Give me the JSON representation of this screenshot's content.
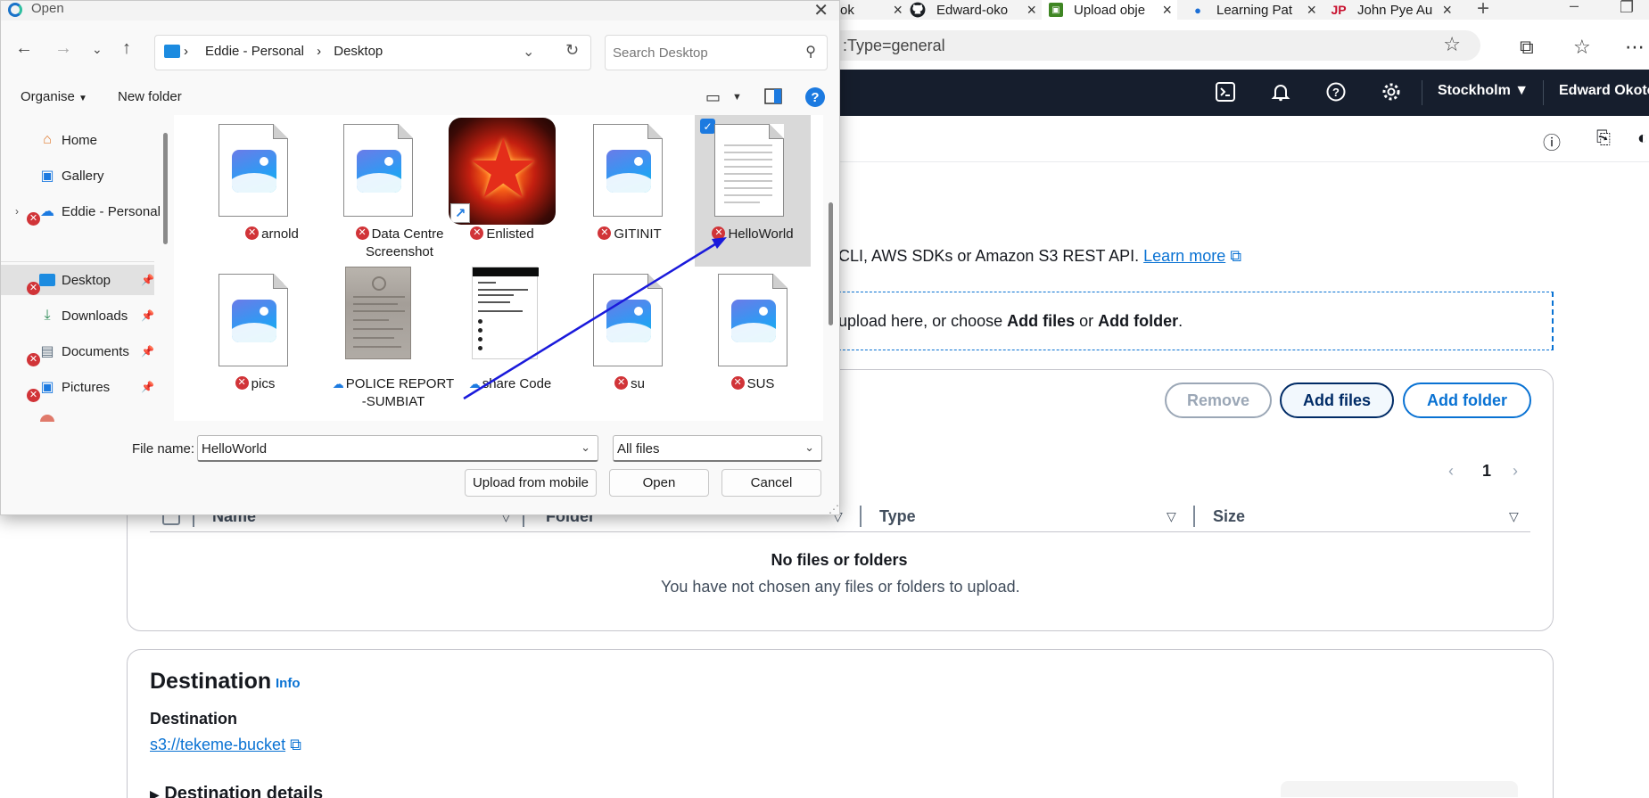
{
  "browser": {
    "tabs": [
      {
        "label": "ok",
        "icon": "book-icon"
      },
      {
        "label": "Edward-oko",
        "icon": "github-icon"
      },
      {
        "label": "Upload obje",
        "icon": "s3-icon"
      },
      {
        "label": "Learning Pat",
        "icon": "learning-icon"
      },
      {
        "label": "John Pye Au",
        "icon": "jp-icon"
      }
    ],
    "url": ":Type=general"
  },
  "aws_header": {
    "region": "Stockholm",
    "user": "Edward Okoto"
  },
  "upload": {
    "desc_prefix": "CLI, AWS SDKs or Amazon S3 REST API.",
    "learn_more": "Learn more",
    "drop_prefix": "upload here, or choose ",
    "drop_add_files": "Add files",
    "drop_or": " or ",
    "drop_add_folder": "Add folder",
    "drop_end": ".",
    "remove_label": "Remove",
    "add_files_label": "Add files",
    "add_folder_label": "Add folder",
    "page_number": "1",
    "columns": {
      "name": "Name",
      "folder": "Folder",
      "type": "Type",
      "size": "Size"
    },
    "empty_title": "No files or folders",
    "empty_sub": "You have not chosen any files or folders to upload."
  },
  "destination": {
    "title": "Destination",
    "info": "Info",
    "label": "Destination",
    "link": "s3://tekeme-bucket",
    "details": "Destination details"
  },
  "dialog": {
    "title": "Open",
    "breadcrumb": [
      "Eddie - Personal",
      "Desktop"
    ],
    "search_placeholder": "Search Desktop",
    "organise": "Organise",
    "new_folder": "New folder",
    "nav_items": [
      {
        "label": "Home",
        "icon": "home-icon"
      },
      {
        "label": "Gallery",
        "icon": "gallery-icon"
      },
      {
        "label": "Eddie - Personal",
        "icon": "onedrive-cloud-icon"
      },
      {
        "label": "Desktop",
        "icon": "desktop-folder-icon"
      },
      {
        "label": "Downloads",
        "icon": "download-icon"
      },
      {
        "label": "Documents",
        "icon": "documents-icon"
      },
      {
        "label": "Pictures",
        "icon": "pictures-icon"
      }
    ],
    "files": [
      {
        "name": "arnold",
        "status": "error"
      },
      {
        "name": "Data Centre Screenshot",
        "status": "error"
      },
      {
        "name": "Enlisted",
        "status": "error"
      },
      {
        "name": "GITINIT",
        "status": "error"
      },
      {
        "name": "HelloWorld",
        "status": "error"
      },
      {
        "name": "pics",
        "status": "error"
      },
      {
        "name": "POLICE REPORT -SUMBIAT",
        "status": "cloud"
      },
      {
        "name": "share Code",
        "status": "cloud"
      },
      {
        "name": "su",
        "status": "error"
      },
      {
        "name": "SUS",
        "status": "error"
      }
    ],
    "selected_file": "HelloWorld",
    "file_name_label": "File name:",
    "file_name_value": "HelloWorld",
    "file_type": "All files",
    "upload_mobile": "Upload from mobile",
    "open": "Open",
    "cancel": "Cancel"
  },
  "colors": {
    "aws_dark": "#161e2d",
    "aws_blue": "#0972d3",
    "error_red": "#d13438",
    "selection": "#d9d9d9",
    "annotation_arrow": "#1a1adb"
  }
}
